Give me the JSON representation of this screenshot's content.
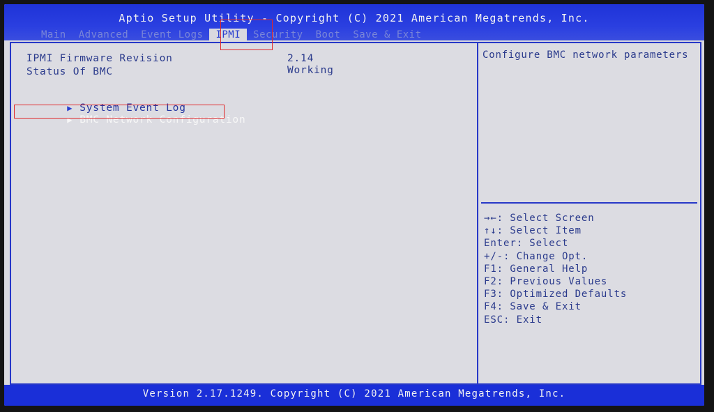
{
  "header": {
    "title": "Aptio Setup Utility - Copyright (C) 2021 American Megatrends, Inc.",
    "tabs": [
      "Main",
      "Advanced",
      "Event Logs",
      "IPMI",
      "Security",
      "Boot",
      "Save & Exit"
    ],
    "active_tab": "IPMI"
  },
  "ipmi": {
    "firmware_label": "IPMI Firmware Revision",
    "firmware_value": "2.14",
    "status_label": "Status Of BMC",
    "status_value": "Working",
    "menu": [
      {
        "label": "System Event Log"
      },
      {
        "label": "BMC Network Configuration"
      }
    ]
  },
  "help": {
    "description": "Configure BMC network parameters",
    "keys": [
      "→←: Select Screen",
      "↑↓: Select Item",
      "Enter: Select",
      "+/-: Change Opt.",
      "F1: General Help",
      "F2: Previous Values",
      "F3: Optimized Defaults",
      "F4: Save & Exit",
      "ESC: Exit"
    ]
  },
  "footer": {
    "version": "Version 2.17.1249. Copyright (C) 2021 American Megatrends, Inc."
  },
  "icons": {
    "submenu_arrow": "▶"
  },
  "colors": {
    "bar_blue": "#1a2fd8",
    "panel_bg": "#dcdce2",
    "text_blue": "#2a3a8c",
    "annotation_red": "#e0282a"
  }
}
